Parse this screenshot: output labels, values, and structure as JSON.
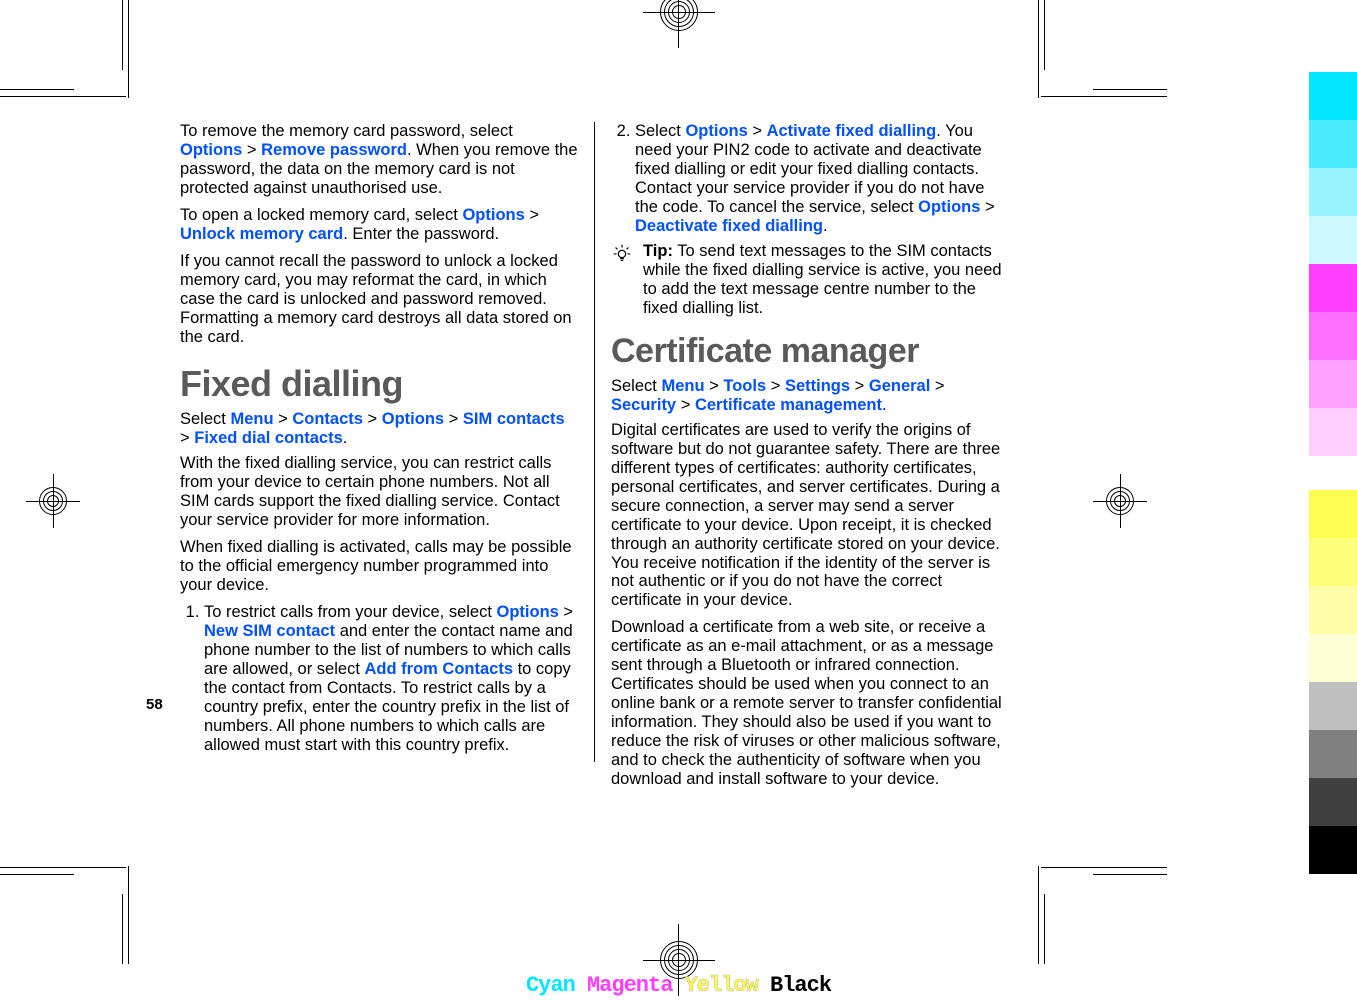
{
  "page_number": "58",
  "left": {
    "p1": {
      "pre": "To remove the memory card password, select ",
      "link1": "Options",
      "sep1": " > ",
      "link2": "Remove password",
      "post": ". When you remove the password, the data on the memory card is not protected against unauthorised use."
    },
    "p2": {
      "pre": "To open a locked memory card, select ",
      "link1": "Options",
      "sep1": " > ",
      "link2": "Unlock memory card",
      "post": ". Enter the password."
    },
    "p3": "If you cannot recall the password to unlock a locked memory card, you may reformat the card, in which case the card is unlocked and password removed. Formatting a memory card destroys all data stored on the card.",
    "h1": "Fixed dialling",
    "p4": {
      "pre": "Select ",
      "link1": "Menu",
      "sep": " > ",
      "link2": "Contacts",
      "link3": "Options",
      "link4": "SIM contacts",
      "link5": "Fixed dial contacts",
      "end": "."
    },
    "p5": "With the fixed dialling service, you can restrict calls from your device to certain phone numbers. Not all SIM cards support the fixed dialling service. Contact your service provider for more information.",
    "p6": "When fixed dialling is activated, calls may be possible to the official emergency number programmed into your device.",
    "li1": {
      "pre": "To restrict calls from your device, select ",
      "link1": "Options",
      "sep": " > ",
      "link2": "New SIM contact",
      "mid1": " and enter the contact name and phone number to the list of numbers to which calls are allowed, or select ",
      "link3": "Add from Contacts",
      "post": " to copy the contact from Contacts. To restrict calls by a country prefix, enter the country prefix in the list of numbers. All phone numbers to which calls are allowed must start with this country prefix."
    }
  },
  "right": {
    "li2": {
      "pre": "Select ",
      "link1": "Options",
      "sep": " > ",
      "link2": "Activate fixed dialling",
      "mid1": ". You need your PIN2 code to activate and deactivate fixed dialling or edit your fixed dialling contacts. Contact your service provider if you do not have the code. To cancel the service, select ",
      "link3": "Options",
      "link4": "Deactivate fixed dialling",
      "end": "."
    },
    "tip_label": "Tip:",
    "tip_text": " To send text messages to the SIM contacts while the fixed dialling service is active, you need to add the text message centre number to the fixed dialling list.",
    "h2": "Certificate manager",
    "p7": {
      "pre": "Select ",
      "link1": "Menu",
      "sep": " > ",
      "link2": "Tools",
      "link3": "Settings",
      "link4": "General",
      "link5": "Security",
      "link6": "Certificate management",
      "end": "."
    },
    "p8": "Digital certificates are used to verify the origins of software but do not guarantee safety. There are three different types of certificates: authority certificates, personal certificates, and server certificates. During a secure connection, a server may send a server certificate to your device. Upon receipt, it is checked through an authority certificate stored on your device. You receive notification if the identity of the server is not authentic or if you do not have the correct certificate in your device.",
    "p9": "Download a certificate from a web site, or receive a certificate as an e-mail attachment, or as a message sent through a Bluetooth or infrared connection. Certificates should be used when you connect to an online bank or a remote server to transfer confidential information. They should also be used if you want to reduce the risk of viruses or other malicious software, and to check the authenticity of software when you download and install software to your device."
  },
  "footer": {
    "cyan": "Cyan",
    "magenta": "Magenta",
    "yellow": "Yellow",
    "black": "Black"
  }
}
